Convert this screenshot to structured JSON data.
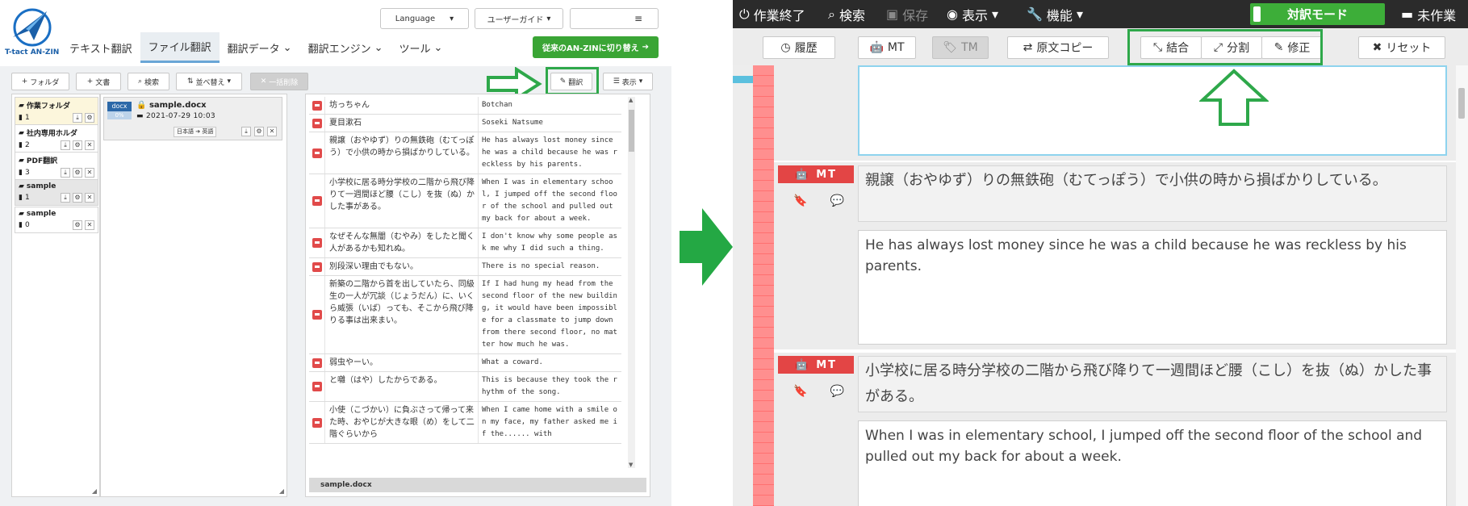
{
  "left": {
    "logo_text": "T-tact AN-ZIN",
    "language_select": "Language",
    "user_guide": "ユーザーガイド",
    "menu_icon": "hamburger-icon",
    "nav": [
      {
        "label": "テキスト翻訳",
        "dropdown": false,
        "active": false
      },
      {
        "label": "ファイル翻訳",
        "dropdown": false,
        "active": true
      },
      {
        "label": "翻訳データ",
        "dropdown": true,
        "active": false
      },
      {
        "label": "翻訳エンジン",
        "dropdown": true,
        "active": false
      },
      {
        "label": "ツール",
        "dropdown": true,
        "active": false
      }
    ],
    "switch_button": "従来のAN-ZINに切り替え",
    "toolbar": {
      "folder": "フォルダ",
      "document": "文書",
      "search": "検索",
      "sort": "並べ替え",
      "bulk_delete": "一括削除",
      "translate": "翻訳",
      "display": "表示"
    },
    "folders": [
      {
        "name": "作業フォルダ",
        "count": "1",
        "style": "hl"
      },
      {
        "name": "社内専用ホルダ",
        "count": "2",
        "style": ""
      },
      {
        "name": "PDF翻訳",
        "count": "3",
        "style": ""
      },
      {
        "name": "sample",
        "count": "1",
        "style": "sel"
      },
      {
        "name": "sample",
        "count": "0",
        "style": ""
      }
    ],
    "file": {
      "type": "docx",
      "progress": "0%",
      "name": "sample.docx",
      "date": "2021-07-29 10:03",
      "source_lang": "日本語",
      "target_lang": "英語"
    },
    "segments": [
      {
        "src": "坊っちゃん",
        "tgt": "Botchan"
      },
      {
        "src": "夏目漱石",
        "tgt": "Soseki Natsume"
      },
      {
        "src": "親譲（おやゆず）りの無鉄砲（むてっぽう）で小供の時から損ばかりしている。",
        "tgt": "He has always lost money since he was a child because he was reckless by his parents."
      },
      {
        "src": "小学校に居る時分学校の二階から飛び降りて一週間ほど腰（こし）を抜（ぬ）かした事がある。",
        "tgt": "When I was in elementary school, I jumped off the second floor of the school and pulled out my back for about a week."
      },
      {
        "src": "なぜそんな無闇（むやみ）をしたと聞く人があるかも知れぬ。",
        "tgt": "I don't know why some people ask me why I did such a thing."
      },
      {
        "src": "別段深い理由でもない。",
        "tgt": "There is no special reason."
      },
      {
        "src": "新築の二階から首を出していたら、同級生の一人が冗談（じょうだん）に、いくら威張（いば）っても、そこから飛び降りる事は出来まい。",
        "tgt": "If I had hung my head from the second floor of the new building, it would have been impossible for a classmate to jump down from there second floor, no matter how much he was."
      },
      {
        "src": "弱虫やーい。",
        "tgt": "What a coward."
      },
      {
        "src": "と囃（はや）したからである。",
        "tgt": "This is because they took the rhythm of the song."
      },
      {
        "src": "小使（こづかい）に負ぶさって帰って来た時、おやじが大きな眼（め）をして二階ぐらいから",
        "tgt": "When I came home with a smile on my face, my father asked me if the...... with"
      }
    ],
    "footer_file": "sample.docx"
  },
  "right": {
    "menu": {
      "finish": "作業終了",
      "search": "検索",
      "save": "保存",
      "view": "表示",
      "function": "機能",
      "untouched": "未作業"
    },
    "mode_label": "対訳モード",
    "tools": {
      "history": "履歴",
      "mt": "MT",
      "tm": "TM",
      "copy_source": "原文コピー",
      "merge": "結合",
      "split": "分割",
      "edit": "修正",
      "reset": "リセット"
    },
    "mt_badge": "MT",
    "segments": [
      {
        "src": "親譲（おやゆず）りの無鉄砲（むてっぽう）で小供の時から損ばかりしている。",
        "tgt": "He has always lost money since he was a child because he was reckless by his parents."
      },
      {
        "src": "小学校に居る時分学校の二階から飛び降りて一週間ほど腰（こし）を抜（ぬ）かした事がある。",
        "tgt": "When I was in elementary school, I jumped off the second floor of the school and pulled out my back for about a week."
      }
    ]
  },
  "colors": {
    "highlight_green": "#2ea84a",
    "mt_red": "#e34545",
    "mode_green": "#3dae39",
    "brand_blue": "#1a5fa8"
  }
}
